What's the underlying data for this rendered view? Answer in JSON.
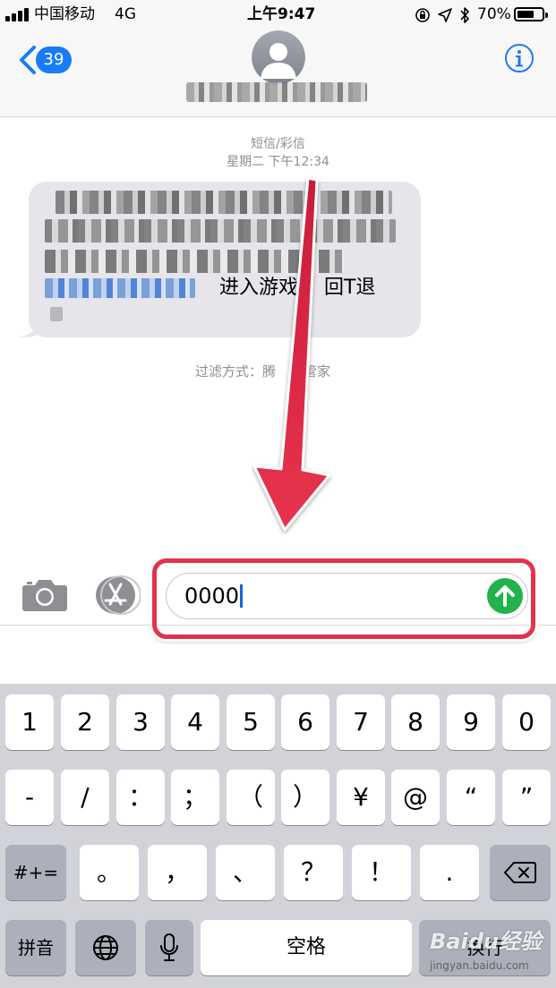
{
  "status_bar": {
    "carrier": "中国移动",
    "network": "4G",
    "time": "上午9:47",
    "battery": "70%",
    "battery_level": 0.7,
    "icons": [
      "signal-icon",
      "orientation-lock-icon",
      "location-icon",
      "bluetooth-icon",
      "battery-icon"
    ]
  },
  "header": {
    "back_badge": "39",
    "contact_name_obscured": true,
    "icons": [
      "back-chevron-icon",
      "contact-avatar-icon",
      "info-icon"
    ]
  },
  "conversation": {
    "service_label": "短信/彩信",
    "timestamp": "星期二 下午12:34",
    "message_visible_fragment": "进入游戏！ 回T退",
    "filter_label": "过滤方式：腾",
    "filter_label_tail": "机管家"
  },
  "input": {
    "value": "0000",
    "icons": [
      "camera-icon",
      "app-store-icon",
      "send-arrow-icon"
    ]
  },
  "keyboard": {
    "row1": [
      "1",
      "2",
      "3",
      "4",
      "5",
      "6",
      "7",
      "8",
      "9",
      "0"
    ],
    "row2": [
      "-",
      "/",
      "：",
      "；",
      "（",
      "）",
      "¥",
      "@",
      "“",
      "”"
    ],
    "row3_left": "#+=",
    "row3": [
      "。",
      "，",
      "、",
      "？",
      "！",
      "."
    ],
    "bottom": {
      "pinyin": "拼音",
      "space": "空格",
      "return": "换行"
    },
    "icons": [
      "delete-key-icon",
      "globe-icon",
      "microphone-icon"
    ]
  },
  "watermark": {
    "brand": "Baidu经验",
    "url": "jingyan.baidu.com"
  },
  "colors": {
    "ios_blue": "#1a7cf5",
    "send_green": "#21b24b",
    "annotation_red": "#e2334a",
    "keyboard_bg": "#d1d3d9",
    "bubble_gray": "#e5e5ea"
  }
}
